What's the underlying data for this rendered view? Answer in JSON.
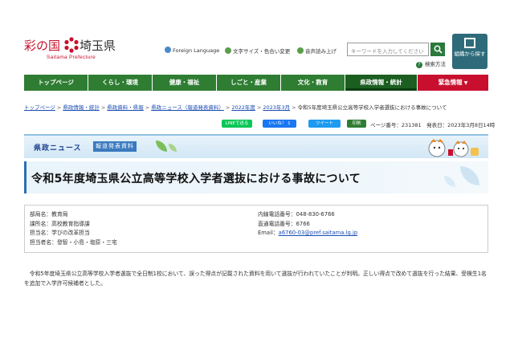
{
  "header": {
    "logo_prefix": "彩の国",
    "logo_name": "埼玉県",
    "logo_sub": "Saitama Prefecture",
    "util_links": [
      "Foreign Language",
      "文字サイズ・色合い変更",
      "音声読み上げ"
    ],
    "search_placeholder": "キーワードを入力してください",
    "search_help": "検索方法",
    "org_button": "組織から探す"
  },
  "nav": {
    "items": [
      "トップページ",
      "くらし・環境",
      "健康・福祉",
      "しごと・産業",
      "文化・教育",
      "県政情報・統計",
      "緊急情報"
    ],
    "active": "県政情報・統計"
  },
  "breadcrumb": {
    "items": [
      "トップページ",
      "県政情報・統計",
      "県政資料・県報",
      "県政ニュース（報道発表資料）",
      "2022年度",
      "2023年3月"
    ],
    "current": "令和5年度埼玉県公立高等学校入学者選抜における事故について"
  },
  "social": {
    "line": "LINEで送る",
    "like": "いいね！ 1",
    "tweet": "ツイート",
    "print": "印刷"
  },
  "page_info": "ページ番号：231381　発表日：2023年3月8日14時",
  "banner": {
    "title": "県政ニュース",
    "sub": "報道発表資料"
  },
  "title": "令和5年度埼玉県公立高等学校入学者選抜における事故について",
  "contact": {
    "left": [
      "部局名：教育局",
      "課所名：高校教育指導課",
      "担当名：学びの改革担当",
      "担当者名：發智・小島・塩原・三宅"
    ],
    "phone": "内線電話番号：048-830-6766",
    "direct": "直通電話番号：6766",
    "email_label": "Email：",
    "email": "a6760-03@pref.saitama.lg.jp"
  },
  "body_text": "　令和5年度埼玉県公立高等学校入学者選抜で全日制1校において、誤った得点が記載された資料を用いて選抜が行われていたことが判明。正しい得点で改めて選抜を行った結果、受検生1名を追加で入学許可候補者とした。",
  "colors": {
    "nav_green": "#2e7d32",
    "nav_active": "#1b5e20",
    "emergency_red": "#c8102e",
    "link_blue": "#1a4db3",
    "org_button": "#2e6b7a",
    "line_green": "#06c755",
    "like_blue": "#1877f2",
    "tweet_blue": "#1d9bf0",
    "print_green": "#2e7d32"
  }
}
